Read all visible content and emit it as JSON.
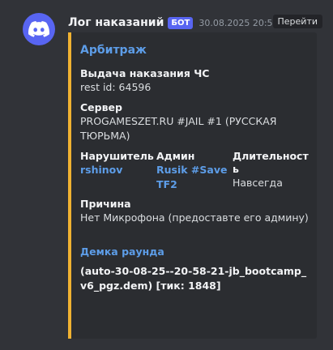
{
  "message": {
    "username": "Лог наказаний",
    "bot_badge": "БОТ",
    "timestamp": "30.08.2025 20:58",
    "goto_label": "Перейти"
  },
  "embed": {
    "accent_color": "#f0b232",
    "author": "Арбитраж",
    "fields": {
      "action": {
        "name": "Выдача наказания ЧС",
        "value": "rest id: 64596"
      },
      "server": {
        "name": "Сервер",
        "value": "PROGAMESZET.RU #JAIL #1 (РУССКАЯ ТЮРЬМА)"
      },
      "offender": {
        "name": "Нарушитель",
        "value": "rshinov"
      },
      "admin": {
        "name": "Админ",
        "value": "Rusik #SaveTF2"
      },
      "duration": {
        "name": "Длительность",
        "value": "Навсегда"
      },
      "reason": {
        "name": "Причина",
        "value": "Нет Микрофона (предоставте его админу)"
      }
    },
    "demo": {
      "title": "Демка раунда",
      "value": "(auto-30-08-25--20-58-21-jb_bootcamp_v6_pgz.dem) [тик: 1848]"
    }
  },
  "icons": {
    "avatar": "discord-logo-icon"
  },
  "colors": {
    "brand": "#5865f2",
    "link": "#5d9de8",
    "background": "#313338",
    "embed_bg": "#2b2d31"
  }
}
